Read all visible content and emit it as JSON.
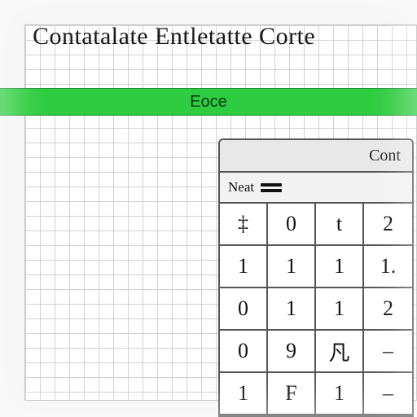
{
  "title": "Contatalate Entletatte Corte",
  "bar_label": "Eoce",
  "panel": {
    "header": "Cont",
    "sub_label": "Neat",
    "keys": [
      "‡",
      "0",
      "t",
      "2",
      "1",
      "1",
      "1",
      "1.",
      "0",
      "1",
      "1",
      "2",
      "0",
      "9",
      "凡",
      "–",
      "1",
      "F",
      "1",
      "–"
    ]
  }
}
